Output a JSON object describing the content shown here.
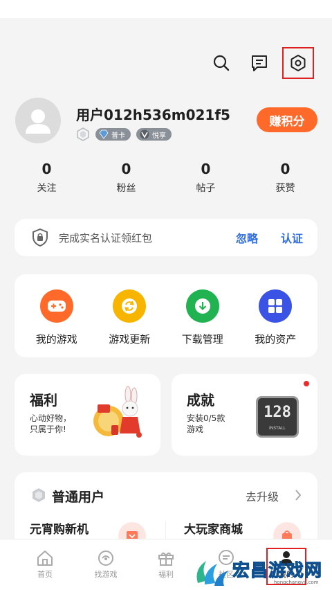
{
  "header": {
    "search_icon": "search-icon",
    "message_icon": "message-icon",
    "settings_icon": "settings-icon"
  },
  "profile": {
    "username": "用户012h536m021f5",
    "badge_putong": "普卡",
    "badge_yuexiang": "悦享",
    "points_button": "赚积分"
  },
  "stats": [
    {
      "value": "0",
      "label": "关注"
    },
    {
      "value": "0",
      "label": "粉丝"
    },
    {
      "value": "0",
      "label": "帖子"
    },
    {
      "value": "0",
      "label": "获赞"
    }
  ],
  "verify": {
    "text": "完成实名认证领红包",
    "ignore": "忽略",
    "auth": "认证"
  },
  "tools": [
    {
      "label": "我的游戏",
      "color": "#ff6a2a",
      "icon": "gamepad-icon"
    },
    {
      "label": "游戏更新",
      "color": "#f7b500",
      "icon": "refresh-icon"
    },
    {
      "label": "下载管理",
      "color": "#21b352",
      "icon": "download-icon"
    },
    {
      "label": "我的资产",
      "color": "#3a53e5",
      "icon": "grid-icon"
    }
  ],
  "welfare": {
    "title": "福利",
    "subtitle": "心动好物，\n只属于你!"
  },
  "achievement": {
    "title": "成就",
    "subtitle": "安装0/5款\n游戏",
    "badge_number": "128",
    "badge_text": "INSTALL"
  },
  "membership": {
    "title": "普通用户",
    "upgrade": "去升级",
    "promo_left": "元宵购新机",
    "promo_right": "大玩家商城"
  },
  "nav": [
    {
      "label": "首页"
    },
    {
      "label": "找游戏"
    },
    {
      "label": "福利"
    },
    {
      "label": "社区"
    },
    {
      "label": "我的"
    }
  ],
  "watermark": {
    "text": "宏昌游戏网",
    "sub": "hongchangyx.com"
  },
  "colors": {
    "accent": "#ff6a2a",
    "link": "#2f6de1",
    "highlight": "#e02020"
  }
}
